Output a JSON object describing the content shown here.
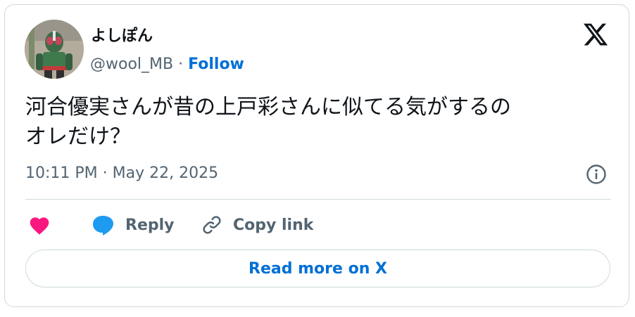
{
  "author": {
    "display_name": "よしぽん",
    "handle": "@wool_MB",
    "separator": "·",
    "follow_label": "Follow"
  },
  "tweet": {
    "text": "河合優実さんが昔の上戸彩さんに似てる気がするの\nオレだけ？",
    "time": "10:11 PM",
    "meta_separator": "·",
    "date": "May 22, 2025"
  },
  "actions": {
    "reply_label": "Reply",
    "copy_link_label": "Copy link"
  },
  "read_more_label": "Read more on X",
  "icons": [
    "x-logo-icon",
    "info-icon",
    "heart-icon",
    "reply-bubble-icon",
    "link-icon"
  ],
  "colors": {
    "accent": "#006fd6",
    "heart": "#f91880",
    "reply_bubble": "#1d9bf0",
    "muted_text": "#536471",
    "border": "#cfd9de"
  }
}
